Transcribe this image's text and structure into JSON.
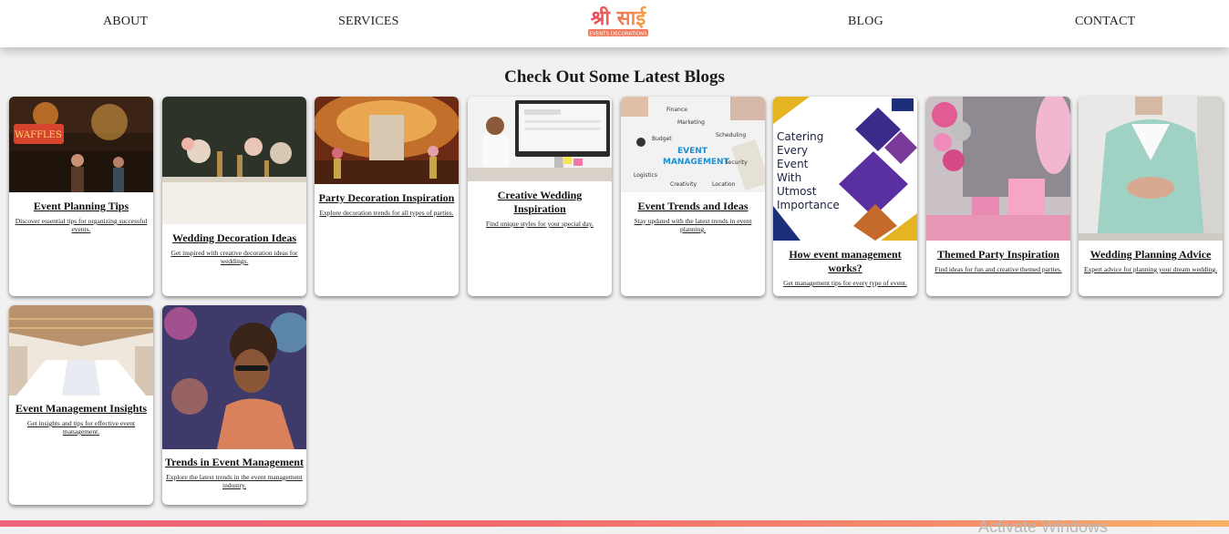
{
  "nav": {
    "about": "ABOUT",
    "services": "SERVICES",
    "blog": "BLOG",
    "contact": "CONTACT"
  },
  "logo": {
    "text_top": "श्री साई",
    "text_bottom": "EVENTS DECORATIONS"
  },
  "section": {
    "heading": "Check Out Some Latest Blogs"
  },
  "blogs": [
    {
      "title": "Event Planning Tips",
      "desc": "Discover essential tips for organizing successful events."
    },
    {
      "title": "Wedding Decoration Ideas",
      "desc": "Get inspired with creative decoration ideas for weddings."
    },
    {
      "title": "Party Decoration Inspiration",
      "desc": "Explore decoration trends for all types of parties."
    },
    {
      "title": "Creative Wedding Inspiration",
      "desc": "Find unique styles for your special day."
    },
    {
      "title": "Event Trends and Ideas",
      "desc": "Stay updated with the latest trends in event planning."
    },
    {
      "title": "How event management works?",
      "desc": "Get management tips for every type of event."
    },
    {
      "title": "Themed Party Inspiration",
      "desc": "Find ideas for fun and creative themed parties."
    },
    {
      "title": "Wedding Planning Advice",
      "desc": "Expert advice for planning your dream wedding."
    },
    {
      "title": "Event Management Insights",
      "desc": "Get insights and tips for effective event management."
    },
    {
      "title": "Trends in Event Management",
      "desc": "Explore the latest trends in the event management industry."
    }
  ],
  "images": {
    "event_mgmt_words": [
      "Finance",
      "Marketing",
      "Scheduling",
      "Budget",
      "EVENT",
      "MANAGEMENT",
      "Security",
      "Logistics",
      "Creativity",
      "Location"
    ],
    "catering_text": "Catering Every Event With Utmost Importance"
  },
  "watermark": "Activate Windows"
}
